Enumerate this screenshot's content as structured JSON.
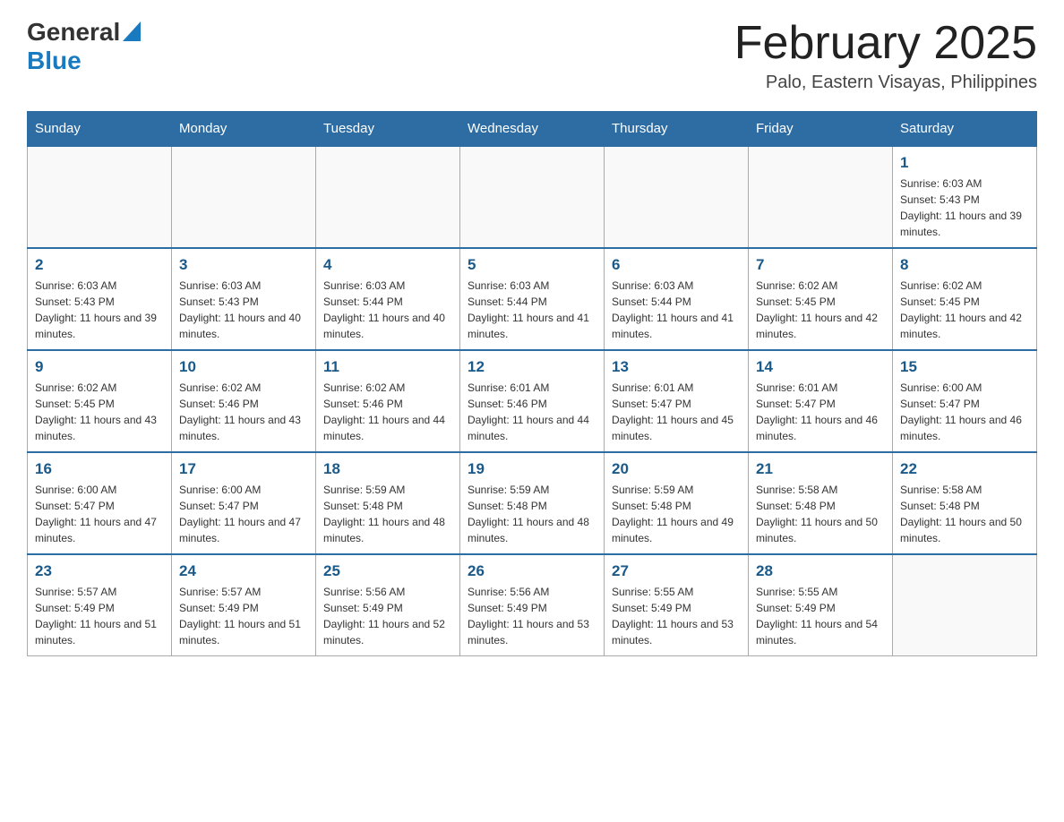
{
  "header": {
    "logo": {
      "line1": "General",
      "arrow_indicator": "▲",
      "line2": "Blue"
    },
    "title": "February 2025",
    "subtitle": "Palo, Eastern Visayas, Philippines"
  },
  "weekdays": [
    "Sunday",
    "Monday",
    "Tuesday",
    "Wednesday",
    "Thursday",
    "Friday",
    "Saturday"
  ],
  "weeks": [
    [
      {
        "day": "",
        "sunrise": "",
        "sunset": "",
        "daylight": ""
      },
      {
        "day": "",
        "sunrise": "",
        "sunset": "",
        "daylight": ""
      },
      {
        "day": "",
        "sunrise": "",
        "sunset": "",
        "daylight": ""
      },
      {
        "day": "",
        "sunrise": "",
        "sunset": "",
        "daylight": ""
      },
      {
        "day": "",
        "sunrise": "",
        "sunset": "",
        "daylight": ""
      },
      {
        "day": "",
        "sunrise": "",
        "sunset": "",
        "daylight": ""
      },
      {
        "day": "1",
        "sunrise": "Sunrise: 6:03 AM",
        "sunset": "Sunset: 5:43 PM",
        "daylight": "Daylight: 11 hours and 39 minutes."
      }
    ],
    [
      {
        "day": "2",
        "sunrise": "Sunrise: 6:03 AM",
        "sunset": "Sunset: 5:43 PM",
        "daylight": "Daylight: 11 hours and 39 minutes."
      },
      {
        "day": "3",
        "sunrise": "Sunrise: 6:03 AM",
        "sunset": "Sunset: 5:43 PM",
        "daylight": "Daylight: 11 hours and 40 minutes."
      },
      {
        "day": "4",
        "sunrise": "Sunrise: 6:03 AM",
        "sunset": "Sunset: 5:44 PM",
        "daylight": "Daylight: 11 hours and 40 minutes."
      },
      {
        "day": "5",
        "sunrise": "Sunrise: 6:03 AM",
        "sunset": "Sunset: 5:44 PM",
        "daylight": "Daylight: 11 hours and 41 minutes."
      },
      {
        "day": "6",
        "sunrise": "Sunrise: 6:03 AM",
        "sunset": "Sunset: 5:44 PM",
        "daylight": "Daylight: 11 hours and 41 minutes."
      },
      {
        "day": "7",
        "sunrise": "Sunrise: 6:02 AM",
        "sunset": "Sunset: 5:45 PM",
        "daylight": "Daylight: 11 hours and 42 minutes."
      },
      {
        "day": "8",
        "sunrise": "Sunrise: 6:02 AM",
        "sunset": "Sunset: 5:45 PM",
        "daylight": "Daylight: 11 hours and 42 minutes."
      }
    ],
    [
      {
        "day": "9",
        "sunrise": "Sunrise: 6:02 AM",
        "sunset": "Sunset: 5:45 PM",
        "daylight": "Daylight: 11 hours and 43 minutes."
      },
      {
        "day": "10",
        "sunrise": "Sunrise: 6:02 AM",
        "sunset": "Sunset: 5:46 PM",
        "daylight": "Daylight: 11 hours and 43 minutes."
      },
      {
        "day": "11",
        "sunrise": "Sunrise: 6:02 AM",
        "sunset": "Sunset: 5:46 PM",
        "daylight": "Daylight: 11 hours and 44 minutes."
      },
      {
        "day": "12",
        "sunrise": "Sunrise: 6:01 AM",
        "sunset": "Sunset: 5:46 PM",
        "daylight": "Daylight: 11 hours and 44 minutes."
      },
      {
        "day": "13",
        "sunrise": "Sunrise: 6:01 AM",
        "sunset": "Sunset: 5:47 PM",
        "daylight": "Daylight: 11 hours and 45 minutes."
      },
      {
        "day": "14",
        "sunrise": "Sunrise: 6:01 AM",
        "sunset": "Sunset: 5:47 PM",
        "daylight": "Daylight: 11 hours and 46 minutes."
      },
      {
        "day": "15",
        "sunrise": "Sunrise: 6:00 AM",
        "sunset": "Sunset: 5:47 PM",
        "daylight": "Daylight: 11 hours and 46 minutes."
      }
    ],
    [
      {
        "day": "16",
        "sunrise": "Sunrise: 6:00 AM",
        "sunset": "Sunset: 5:47 PM",
        "daylight": "Daylight: 11 hours and 47 minutes."
      },
      {
        "day": "17",
        "sunrise": "Sunrise: 6:00 AM",
        "sunset": "Sunset: 5:47 PM",
        "daylight": "Daylight: 11 hours and 47 minutes."
      },
      {
        "day": "18",
        "sunrise": "Sunrise: 5:59 AM",
        "sunset": "Sunset: 5:48 PM",
        "daylight": "Daylight: 11 hours and 48 minutes."
      },
      {
        "day": "19",
        "sunrise": "Sunrise: 5:59 AM",
        "sunset": "Sunset: 5:48 PM",
        "daylight": "Daylight: 11 hours and 48 minutes."
      },
      {
        "day": "20",
        "sunrise": "Sunrise: 5:59 AM",
        "sunset": "Sunset: 5:48 PM",
        "daylight": "Daylight: 11 hours and 49 minutes."
      },
      {
        "day": "21",
        "sunrise": "Sunrise: 5:58 AM",
        "sunset": "Sunset: 5:48 PM",
        "daylight": "Daylight: 11 hours and 50 minutes."
      },
      {
        "day": "22",
        "sunrise": "Sunrise: 5:58 AM",
        "sunset": "Sunset: 5:48 PM",
        "daylight": "Daylight: 11 hours and 50 minutes."
      }
    ],
    [
      {
        "day": "23",
        "sunrise": "Sunrise: 5:57 AM",
        "sunset": "Sunset: 5:49 PM",
        "daylight": "Daylight: 11 hours and 51 minutes."
      },
      {
        "day": "24",
        "sunrise": "Sunrise: 5:57 AM",
        "sunset": "Sunset: 5:49 PM",
        "daylight": "Daylight: 11 hours and 51 minutes."
      },
      {
        "day": "25",
        "sunrise": "Sunrise: 5:56 AM",
        "sunset": "Sunset: 5:49 PM",
        "daylight": "Daylight: 11 hours and 52 minutes."
      },
      {
        "day": "26",
        "sunrise": "Sunrise: 5:56 AM",
        "sunset": "Sunset: 5:49 PM",
        "daylight": "Daylight: 11 hours and 53 minutes."
      },
      {
        "day": "27",
        "sunrise": "Sunrise: 5:55 AM",
        "sunset": "Sunset: 5:49 PM",
        "daylight": "Daylight: 11 hours and 53 minutes."
      },
      {
        "day": "28",
        "sunrise": "Sunrise: 5:55 AM",
        "sunset": "Sunset: 5:49 PM",
        "daylight": "Daylight: 11 hours and 54 minutes."
      },
      {
        "day": "",
        "sunrise": "",
        "sunset": "",
        "daylight": ""
      }
    ]
  ]
}
